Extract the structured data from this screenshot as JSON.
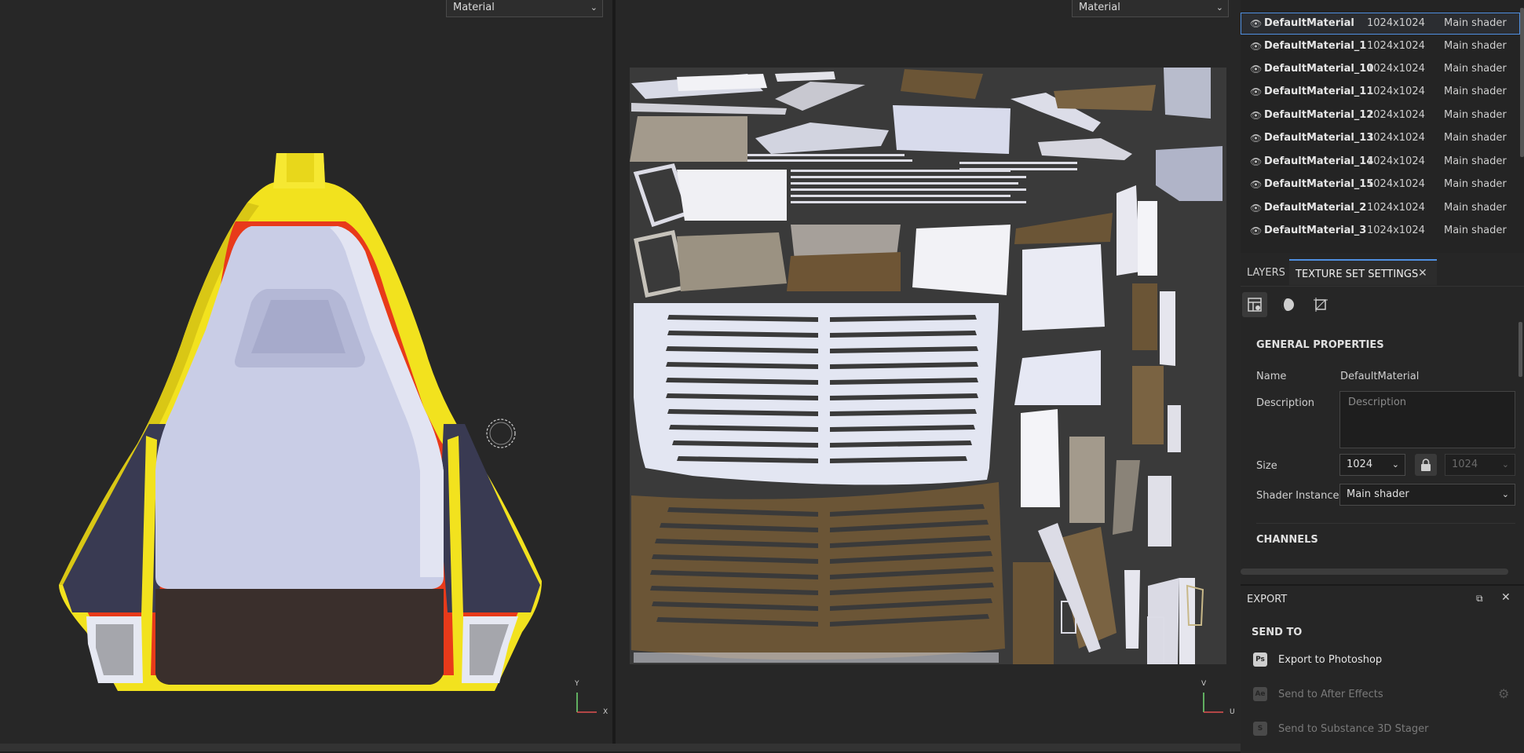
{
  "viewport3d": {
    "mode_select": "Material",
    "axis_x": "X",
    "axis_y": "Y"
  },
  "viewport2d": {
    "mode_select": "Material",
    "axis_u": "U",
    "axis_v": "V"
  },
  "texture_sets": [
    {
      "name": "DefaultMaterial",
      "resolution": "1024x1024",
      "shader": "Main shader",
      "selected": true
    },
    {
      "name": "DefaultMaterial_1",
      "resolution": "1024x1024",
      "shader": "Main shader"
    },
    {
      "name": "DefaultMaterial_10",
      "resolution": "1024x1024",
      "shader": "Main shader"
    },
    {
      "name": "DefaultMaterial_11",
      "resolution": "1024x1024",
      "shader": "Main shader"
    },
    {
      "name": "DefaultMaterial_12",
      "resolution": "1024x1024",
      "shader": "Main shader"
    },
    {
      "name": "DefaultMaterial_13",
      "resolution": "1024x1024",
      "shader": "Main shader"
    },
    {
      "name": "DefaultMaterial_14",
      "resolution": "1024x1024",
      "shader": "Main shader"
    },
    {
      "name": "DefaultMaterial_15",
      "resolution": "1024x1024",
      "shader": "Main shader"
    },
    {
      "name": "DefaultMaterial_2",
      "resolution": "1024x1024",
      "shader": "Main shader"
    },
    {
      "name": "DefaultMaterial_3",
      "resolution": "1024x1024",
      "shader": "Main shader"
    }
  ],
  "tabs": {
    "layers": "LAYERS",
    "texture_set_settings": "TEXTURE SET SETTINGS",
    "close": "✕"
  },
  "properties": {
    "section_general": "GENERAL PROPERTIES",
    "name_label": "Name",
    "name_value": "DefaultMaterial",
    "description_label": "Description",
    "description_placeholder": "Description",
    "size_label": "Size",
    "size_value": "1024",
    "size_value_locked": "1024",
    "shader_label": "Shader Instance",
    "shader_value": "Main shader",
    "section_channels": "CHANNELS"
  },
  "export": {
    "title": "EXPORT",
    "send_to": "SEND TO",
    "items": [
      {
        "icon": "Ps",
        "label": "Export to Photoshop",
        "enabled": true
      },
      {
        "icon": "Ae",
        "label": "Send to After Effects",
        "enabled": false
      },
      {
        "icon": "stager-icon",
        "label": "Send to Substance 3D Stager",
        "enabled": false
      }
    ]
  },
  "colors": {
    "accent": "#4f8fe0",
    "mesh_yellow": "#f2e21e",
    "mesh_red": "#e83a1a",
    "mesh_white": "#c9cde6",
    "mesh_navy": "#393a52",
    "mesh_brown": "#3a2f2c",
    "uv_brown": "#6b5536"
  }
}
